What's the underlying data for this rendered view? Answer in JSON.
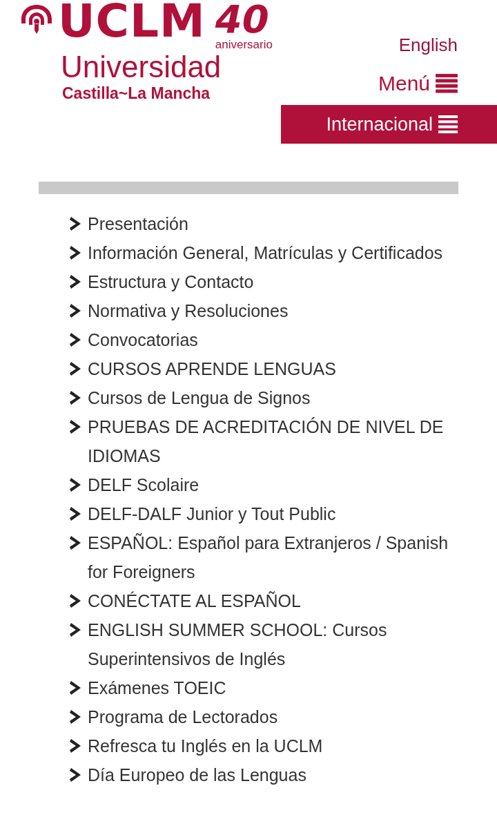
{
  "logo": {
    "acronym": "UCLM",
    "anniversary_number": "40",
    "anniversary_label": "aniversario",
    "name": "Universidad",
    "region": "Castilla~La Mancha"
  },
  "header": {
    "language_link": "English",
    "menu_button": "Menú",
    "section_button": "Internacional"
  },
  "nav_items": [
    {
      "label": "Presentación"
    },
    {
      "label": "Información General, Matrículas y Certificados"
    },
    {
      "label": "Estructura y Contacto"
    },
    {
      "label": "Normativa y Resoluciones"
    },
    {
      "label": "Convocatorias"
    },
    {
      "label": "CURSOS APRENDE LENGUAS"
    },
    {
      "label": "Cursos de Lengua de Signos"
    },
    {
      "label": "PRUEBAS DE ACREDITACIÓN DE NIVEL DE IDIOMAS"
    },
    {
      "label": "DELF Scolaire"
    },
    {
      "label": "DELF-DALF Junior y Tout Public"
    },
    {
      "label": "ESPAÑOL: Español para Extranjeros / Spanish for Foreigners"
    },
    {
      "label": "CONÉCTATE AL ESPAÑOL"
    },
    {
      "label": "ENGLISH SUMMER SCHOOL: Cursos Superintensivos de Inglés"
    },
    {
      "label": "Exámenes TOEIC"
    },
    {
      "label": "Programa de Lectorados"
    },
    {
      "label": "Refresca tu Inglés en la UCLM"
    },
    {
      "label": "Día Europeo de las Lenguas"
    }
  ]
}
